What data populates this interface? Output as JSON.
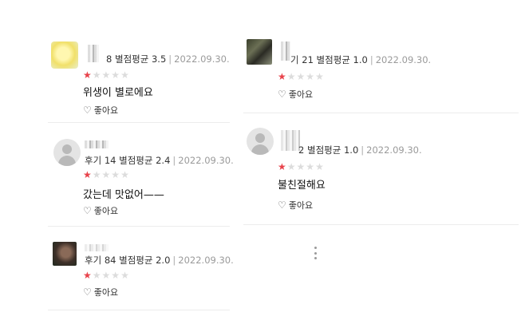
{
  "reviews": [
    {
      "id": "r1",
      "avatar": "yellow-photo",
      "meta_prefix": "",
      "reviews_count": "8",
      "rating_label": "별점평균",
      "rating_avg": "3.5",
      "date": "2022.09.30.",
      "stars": 1,
      "content": "위생이 별로에요",
      "like_label": "좋아요"
    },
    {
      "id": "r2",
      "avatar": "default",
      "meta_prefix": "후기",
      "reviews_count": "14",
      "rating_label": "별점평균",
      "rating_avg": "2.4",
      "date": "2022.09.30.",
      "stars": 1,
      "content": "갔는데 맛없어——",
      "like_label": "좋아요"
    },
    {
      "id": "r3",
      "avatar": "face-photo",
      "meta_prefix": "후기",
      "reviews_count": "84",
      "rating_label": "별점평균",
      "rating_avg": "2.0",
      "date": "2022.09.30.",
      "stars": 1,
      "content": "",
      "like_label": "좋아요"
    },
    {
      "id": "r4",
      "avatar": "dark-photo",
      "meta_prefix": "기",
      "reviews_count": "21",
      "rating_label": "별점평균",
      "rating_avg": "1.0",
      "date": "2022.09.30.",
      "stars": 1,
      "content": "",
      "like_label": "좋아요"
    },
    {
      "id": "r5",
      "avatar": "default",
      "meta_prefix": "",
      "reviews_count": "2",
      "rating_label": "별점평균",
      "rating_avg": "1.0",
      "date": "2022.09.30.",
      "stars": 1,
      "content": "불친절해요",
      "like_label": "좋아요"
    }
  ],
  "icons": {
    "heart": "heart-outline-icon",
    "star": "star-icon",
    "more": "more-vertical-icon"
  },
  "colors": {
    "star_on": "#e8434b",
    "star_off": "#dcdcdc",
    "date": "#9a9a9a"
  }
}
